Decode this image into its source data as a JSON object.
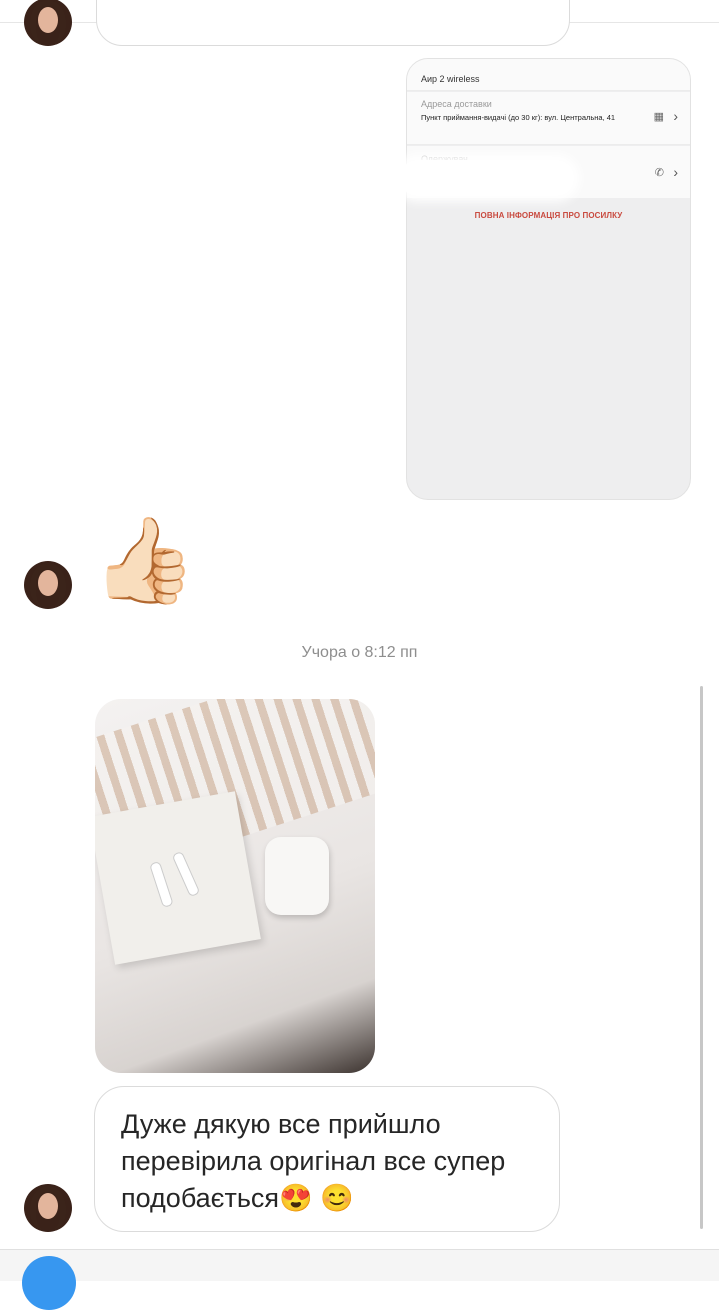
{
  "shared_card": {
    "title": "Аир 2 wireless",
    "address_label": "Адреса доставки",
    "address_value": "Пункт приймання-видачі (до 30 кг): вул. Центральна, 41",
    "recipient_label": "Одержувач",
    "full_info_link": "ПОВНА ІНФОРМАЦІЯ ПРО ПОСИЛКУ"
  },
  "reaction": {
    "emoji": "👍🏻"
  },
  "timestamp": "Учора о 8:12 пп",
  "message": {
    "text": "Дуже дякую все прийшло перевірила оригінал все супер подобається😍 😊"
  },
  "icons": {
    "map": "map-icon",
    "phone": "phone-icon",
    "chevron": "chevron-right-icon"
  }
}
